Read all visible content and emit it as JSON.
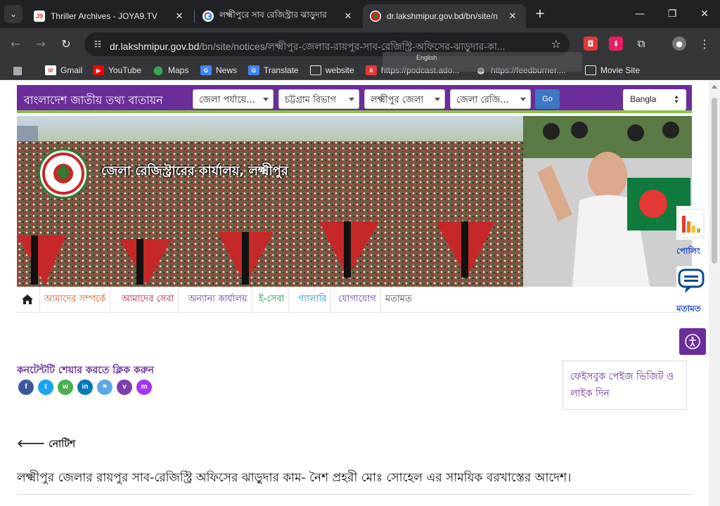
{
  "browser": {
    "tabs": [
      {
        "title": "Thriller Archives - JOYA9.TV",
        "favicon": "joya9-icon"
      },
      {
        "title": "লক্ষ্মীপুরে সাব রেজিস্ট্রার ঝাড়ুদার",
        "favicon": "google-icon"
      },
      {
        "title": "dr.lakshmipur.gov.bd/bn/site/n",
        "favicon": "gov-bd-icon"
      }
    ],
    "joya_badge": "J9",
    "url_host": "dr.lakshmipur.gov.bd",
    "url_path": "/bn/site/notices/লক্ষ্মীপুর-জেলার-রায়পুর-সাব-রেজিস্ট্রি-অফিসের-ঝাড়ুদার-কা...",
    "overlay_lang": "English",
    "bookmarks": [
      {
        "label": "Gmail",
        "icon": "gmail-icon"
      },
      {
        "label": "YouTube",
        "icon": "youtube-icon"
      },
      {
        "label": "Maps",
        "icon": "maps-icon"
      },
      {
        "label": "News",
        "icon": "news-icon"
      },
      {
        "label": "Translate",
        "icon": "translate-icon"
      },
      {
        "label": "website",
        "icon": "folder-icon"
      },
      {
        "label": "https://podcast.ado...",
        "icon": "adobe-icon"
      },
      {
        "label": "https://feedburner....",
        "icon": "globe-icon"
      },
      {
        "label": "Movie Site",
        "icon": "folder-icon"
      }
    ]
  },
  "portal": {
    "title": "বাংলাদেশ জাতীয় তথ্য বাতায়ন",
    "selects": [
      "জেলা পর্যায়ে...",
      "চট্টগ্রাম বিভাগ",
      "লক্ষ্মীপুর জেলা",
      "জেলা রেজি..."
    ],
    "go_label": "Go",
    "language": "Bangla"
  },
  "banner": {
    "office_title": "জেলা রেজিস্ট্রারের কার্যালয়, লক্ষ্মীপুর"
  },
  "menu": {
    "items": [
      {
        "label": "আমাদের সম্পর্কে",
        "color": "#e5501f"
      },
      {
        "label": "আমাদের সেবা",
        "color": "#c0142c"
      },
      {
        "label": "অন্যান্য কার্যালয়",
        "color": "#6a2d9a"
      },
      {
        "label": "ই-সেবা",
        "color": "#0a9b46"
      },
      {
        "label": "গ্যালারি",
        "color": "#1597b8"
      },
      {
        "label": "যোগাযোগ",
        "color": "#6a2d9a"
      },
      {
        "label": "মতামত",
        "color": "#333333"
      }
    ]
  },
  "side": {
    "poll_label": "পোলিং",
    "feedback_label": "মতামত"
  },
  "share": {
    "title": "কনটেন্টটি শেয়ার করতে ক্লিক করুন",
    "buttons": [
      {
        "icon": "facebook-icon",
        "glyph": "f",
        "color": "#3b5998"
      },
      {
        "icon": "twitter-icon",
        "glyph": "t",
        "color": "#1da1f2"
      },
      {
        "icon": "whatsapp-icon",
        "glyph": "w",
        "color": "#4caf50"
      },
      {
        "icon": "linkedin-icon",
        "glyph": "in",
        "color": "#0077b5"
      },
      {
        "icon": "link-icon",
        "glyph": "⚭",
        "color": "#5aa9e6"
      },
      {
        "icon": "viber-icon",
        "glyph": "v",
        "color": "#7d3daf"
      },
      {
        "icon": "messenger-icon",
        "glyph": "m",
        "color": "#a334fa"
      }
    ]
  },
  "facebook_box": "ফেইসবুক পেইজ ভিজিট ও লাইক দিন",
  "notice": {
    "back_label": "নোটিশ",
    "title": "লক্ষ্মীপুর জেলার রায়পুর সাব-রেজিস্ট্রি অফিসের ঝাড়ুদার কাম- নৈশ প্রহরী মোঃ সোহেল এর সাময়িক বরখাস্তের আদেশ।"
  },
  "colors": {
    "portal_purple": "#6a2d9a",
    "portal_green": "#8bc34a",
    "go_blue": "#3c78c3"
  }
}
